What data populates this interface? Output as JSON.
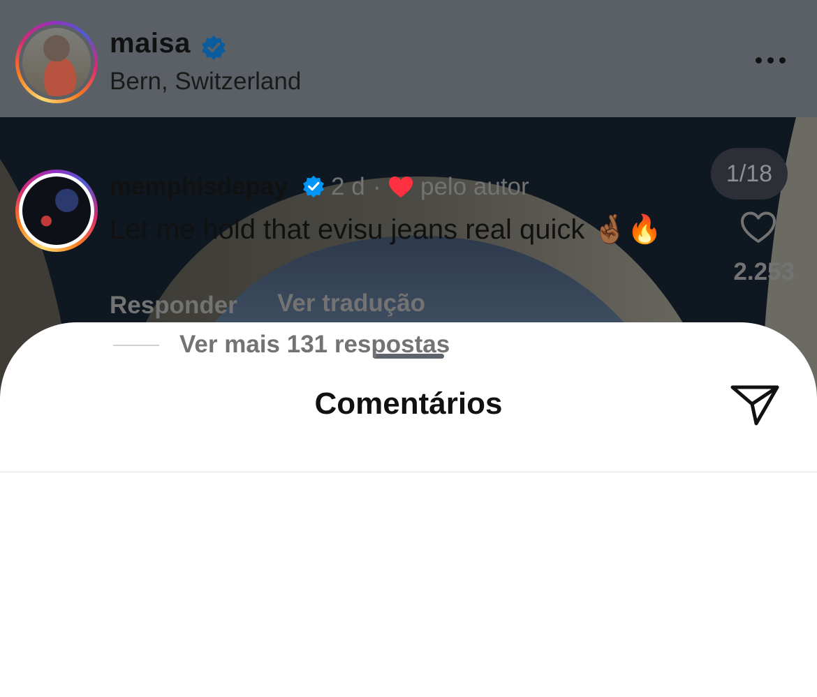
{
  "post": {
    "username": "maisa",
    "location": "Bern, Switzerland",
    "media_counter": "1/18"
  },
  "comments_sheet": {
    "title": "Comentários",
    "comment": {
      "username": "memphisdepay",
      "time": "2 d",
      "separator": "·",
      "liked_by": "pelo autor",
      "text": "Let me hold that evisu jeans real quick 🤞🏾🔥",
      "like_count": "2.253",
      "reply_label": "Responder",
      "translate_label": "Ver tradução",
      "view_replies_label": "Ver mais 131 respostas"
    }
  },
  "colors": {
    "verified_blue": "#0095f6",
    "heart_red": "#ff3040",
    "secondary_text": "#737373"
  },
  "icons": [
    "verified-badge-icon",
    "more-options-icon",
    "share-icon",
    "heart-icon",
    "like-heart-icon"
  ]
}
